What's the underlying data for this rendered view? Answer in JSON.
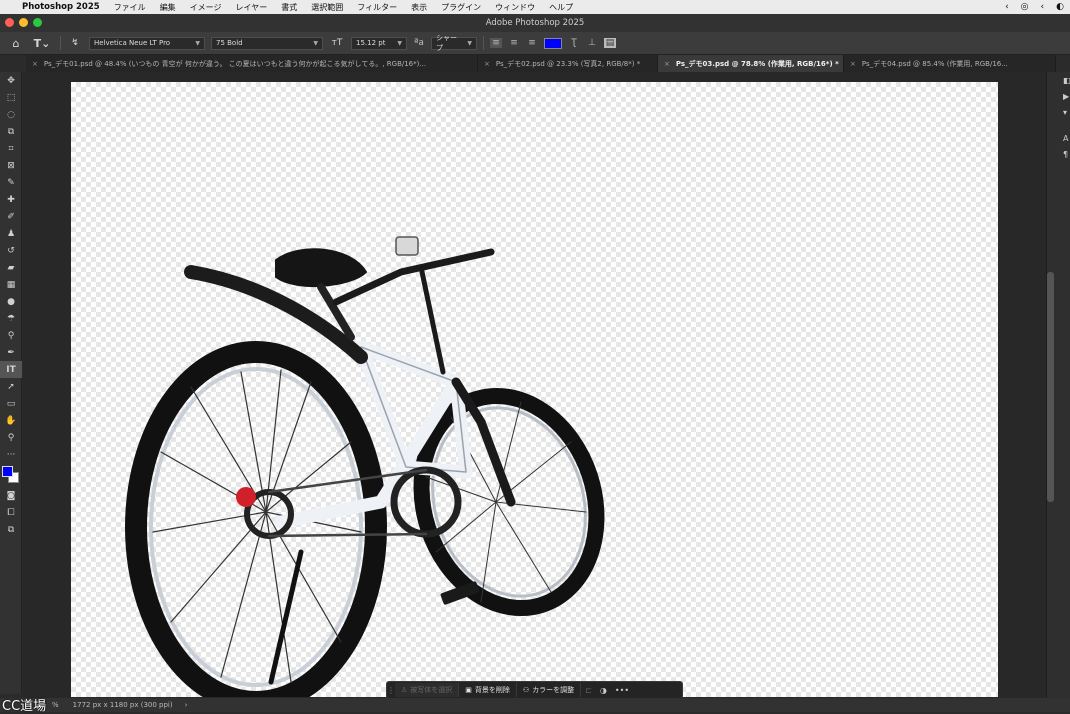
{
  "menubar": {
    "app_name": "Photoshop 2025",
    "items": [
      "ファイル",
      "編集",
      "イメージ",
      "レイヤー",
      "書式",
      "選択範囲",
      "フィルター",
      "表示",
      "プラグイン",
      "ウィンドウ",
      "ヘルプ"
    ]
  },
  "window": {
    "title": "Adobe Photoshop 2025"
  },
  "options_bar": {
    "font_family": "Helvetica Neue LT Pro",
    "font_style": "75 Bold",
    "font_size": "15.12 pt",
    "antialias": "シャープ",
    "text_color": "#0000ff"
  },
  "tabs": [
    {
      "label": "Ps_デモ01.psd @ 48.4% (いつもの 青空が 何かが違う。 この夏はいつもと違う何かが起こる気がしてる。, RGB/16*)..."
    },
    {
      "label": "Ps_デモ02.psd @ 23.3% (写真2, RGB/8*) *"
    },
    {
      "label": "Ps_デモ03.psd @ 78.8% (作業用, RGB/16*) *"
    },
    {
      "label": "Ps_デモ04.psd @ 85.4% (作業用, RGB/16..."
    }
  ],
  "active_tab_index": 2,
  "toolbar": {
    "foreground_color": "#0000ff",
    "background_color": "#ffffff"
  },
  "context_bar": {
    "select_subject": "被写体を選択",
    "remove_background": "背景を削除",
    "adjust_color": "カラーを調整"
  },
  "status": {
    "zoom": "%",
    "doc_size": "1772 px x 1180 px (300 ppi)"
  },
  "watermark": "CC道場"
}
